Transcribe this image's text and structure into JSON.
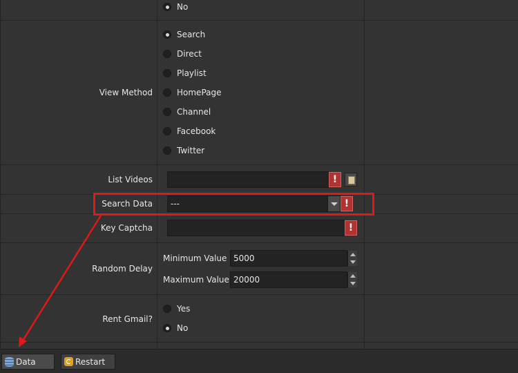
{
  "rows": {
    "top_radio": "No",
    "view_method": {
      "label": "View Method",
      "options": [
        "Search",
        "Direct",
        "Playlist",
        "HomePage",
        "Channel",
        "Facebook",
        "Twitter"
      ],
      "selected": "Search"
    },
    "list_videos": {
      "label": "List Videos",
      "value": ""
    },
    "search_data": {
      "label": "Search Data",
      "value": "---"
    },
    "key_captcha": {
      "label": "Key Captcha",
      "value": ""
    },
    "random_delay": {
      "label": "Random Delay",
      "min_label": "Minimum Value",
      "min_value": "5000",
      "max_label": "Maximum Value",
      "max_value": "20000"
    },
    "rent_gmail": {
      "label": "Rent Gmail?",
      "options": [
        "Yes",
        "No"
      ],
      "selected": "No"
    }
  },
  "error_icon": "!",
  "toolbar": {
    "data_label": "Data",
    "restart_label": "Restart"
  },
  "colors": {
    "highlight": "#e01818",
    "error": "#b23232",
    "background": "#333333"
  }
}
